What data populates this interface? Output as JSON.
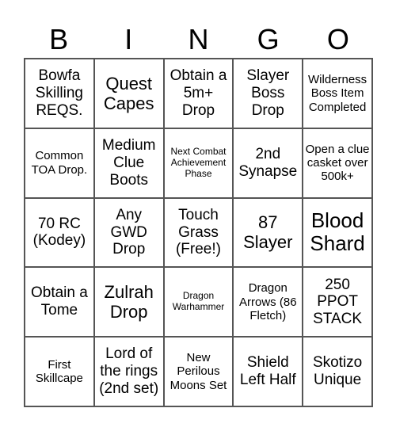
{
  "header": [
    "B",
    "I",
    "N",
    "G",
    "O"
  ],
  "cells": [
    {
      "text": "Bowfa Skilling REQS.",
      "size": "m"
    },
    {
      "text": "Quest Capes",
      "size": "l"
    },
    {
      "text": "Obtain a 5m+ Drop",
      "size": "m"
    },
    {
      "text": "Slayer Boss Drop",
      "size": "m"
    },
    {
      "text": "Wilderness Boss Item Completed",
      "size": "s"
    },
    {
      "text": "Common TOA Drop.",
      "size": "s"
    },
    {
      "text": "Medium Clue Boots",
      "size": "m"
    },
    {
      "text": "Next Combat Achievement Phase",
      "size": "xs"
    },
    {
      "text": "2nd Synapse",
      "size": "m"
    },
    {
      "text": "Open a clue casket over 500k+",
      "size": "s"
    },
    {
      "text": "70 RC (Kodey)",
      "size": "m"
    },
    {
      "text": "Any GWD Drop",
      "size": "m"
    },
    {
      "text": "Touch Grass (Free!)",
      "size": "m"
    },
    {
      "text": "87 Slayer",
      "size": "l"
    },
    {
      "text": "Blood Shard",
      "size": "xl"
    },
    {
      "text": "Obtain a Tome",
      "size": "m"
    },
    {
      "text": "Zulrah Drop",
      "size": "l"
    },
    {
      "text": "Dragon Warhammer",
      "size": "xs"
    },
    {
      "text": "Dragon Arrows (86 Fletch)",
      "size": "s"
    },
    {
      "text": "250 PPOT STACK",
      "size": "m"
    },
    {
      "text": "First Skillcape",
      "size": "s"
    },
    {
      "text": "Lord of the rings (2nd set)",
      "size": "m"
    },
    {
      "text": "New Perilous Moons Set",
      "size": "s"
    },
    {
      "text": "Shield Left Half",
      "size": "m"
    },
    {
      "text": "Skotizo Unique",
      "size": "m"
    }
  ]
}
